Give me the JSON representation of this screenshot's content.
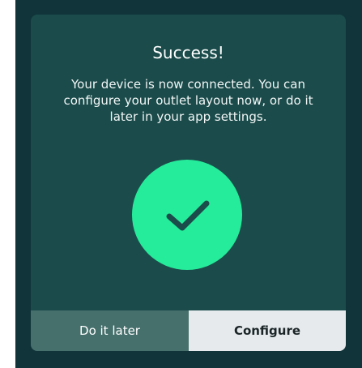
{
  "dialog": {
    "title": "Success!",
    "message": "Your device is now connected. You can configure your outlet layout now, or do it later in your app settings.",
    "icon": "checkmark-icon"
  },
  "buttons": {
    "later_label": "Do it later",
    "configure_label": "Configure"
  },
  "colors": {
    "backdrop": "#10343a",
    "dialog_bg": "#1b4b4b",
    "success_green": "#25ec9a",
    "secondary_button": "#46706c",
    "primary_button": "#e6eaec"
  }
}
